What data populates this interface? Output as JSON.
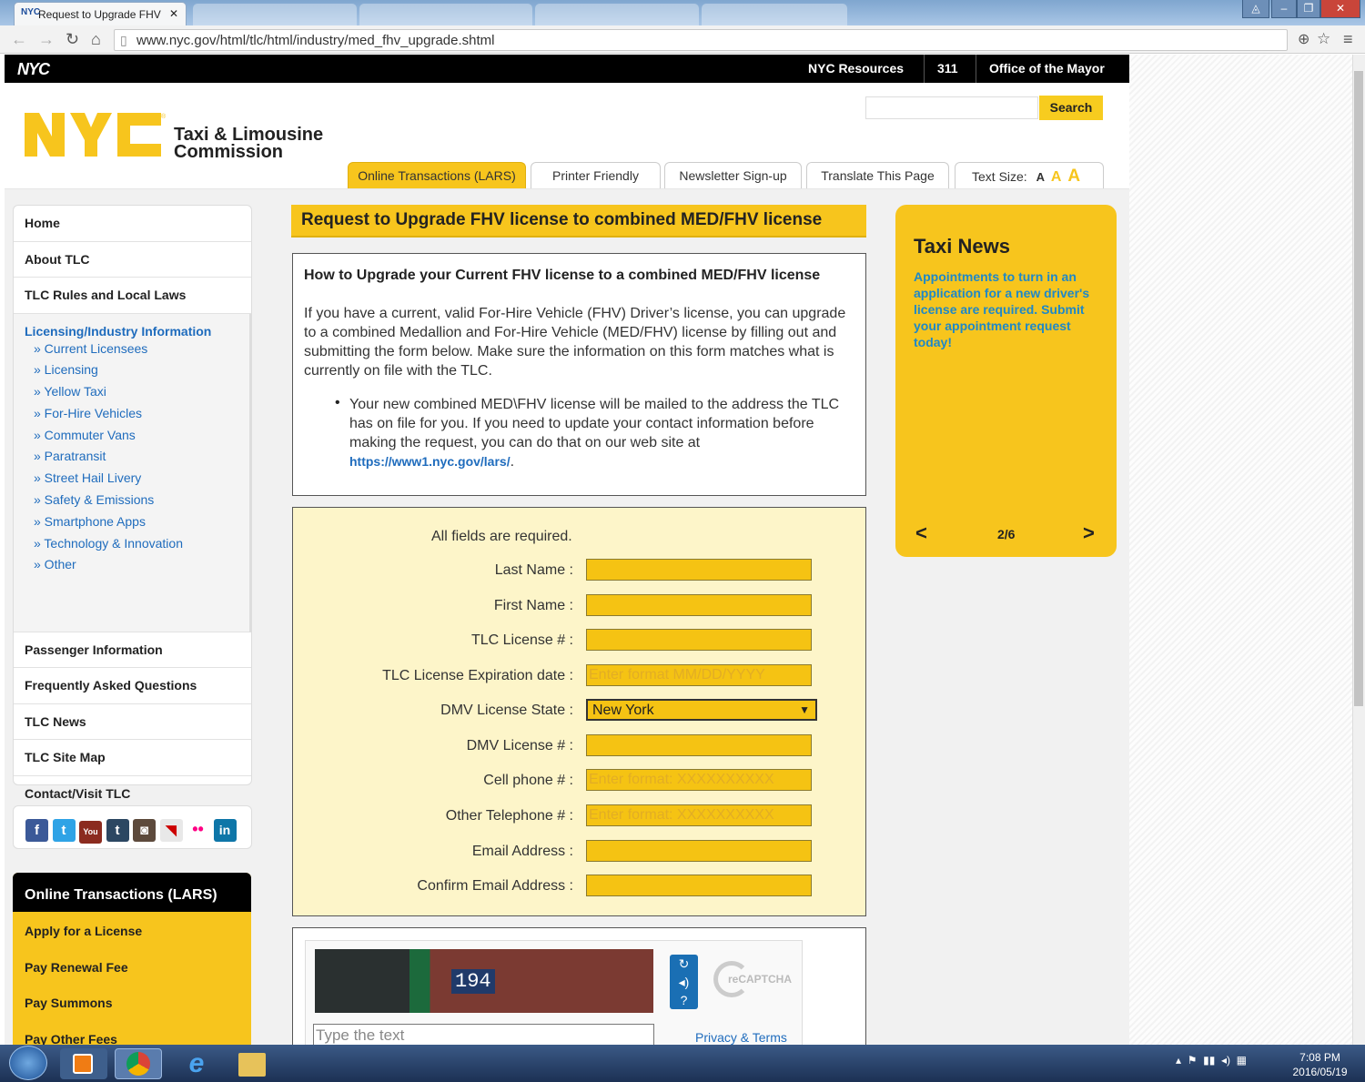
{
  "browser": {
    "tab_title": "Request to Upgrade FHV",
    "url": "www.nyc.gov/html/tlc/html/industry/med_fhv_upgrade.shtml"
  },
  "topbar": {
    "brand": "NYC",
    "links": [
      "NYC Resources",
      "311",
      "Office of the Mayor"
    ]
  },
  "header": {
    "logo_text": "NYC",
    "agency_line1": "Taxi & Limousine",
    "agency_line2": "Commission",
    "search_label": "Search",
    "tabs": [
      "Online Transactions (LARS)",
      "Printer Friendly",
      "Newsletter Sign-up",
      "Translate This Page"
    ],
    "text_size_label": "Text Size:",
    "text_size_glyph": "A"
  },
  "sidebar": {
    "top_items": [
      "Home",
      "About TLC",
      "TLC Rules and Local Laws"
    ],
    "active_item": "Licensing/Industry Information",
    "sub_items": [
      "» Current Licensees",
      "» Licensing",
      "» Yellow Taxi",
      "» For-Hire Vehicles",
      "» Commuter Vans",
      "» Paratransit",
      "» Street Hail Livery",
      "» Safety & Emissions",
      "» Smartphone Apps",
      "» Technology & Innovation",
      "» Other"
    ],
    "bottom_items": [
      "Passenger Information",
      "Frequently Asked Questions",
      "TLC News",
      "TLC Site Map",
      "Contact/Visit TLC"
    ],
    "social_icons": [
      "facebook-icon",
      "twitter-icon",
      "youtube-icon",
      "tumblr-icon",
      "instagram-icon",
      "ndf-icon",
      "flickr-icon",
      "linkedin-icon"
    ],
    "lars": {
      "title": "Online Transactions (LARS)",
      "items": [
        "Apply for a License",
        "Pay Renewal Fee",
        "Pay Summons",
        "Pay Other Fees"
      ]
    }
  },
  "main": {
    "title": "Request to Upgrade FHV license to combined MED/FHV license",
    "info_heading": "How to Upgrade your Current FHV license to a combined MED/FHV license",
    "info_paragraph": "If you have a current, valid For-Hire Vehicle (FHV) Driver’s license, you can upgrade to a combined Medallion and For-Hire Vehicle (MED/FHV) license by filling out and submitting the form below. Make sure the information on this form matches what is currently on file with the TLC.",
    "bullet_text": "Your new combined MED\\FHV license will be mailed to the address the TLC has on file for you. If you need to update your contact information before making the request, you can do that on our web site at",
    "bullet_link": "https://www1.nyc.gov/lars/",
    "form": {
      "required_note": "All fields are required.",
      "fields": [
        {
          "label": "Last Name :",
          "value": "",
          "placeholder": ""
        },
        {
          "label": "First Name :",
          "value": "",
          "placeholder": ""
        },
        {
          "label": "TLC License # :",
          "value": "",
          "placeholder": ""
        },
        {
          "label": "TLC License Expiration date :",
          "value": "",
          "placeholder": "Enter format MM/DD/YYYY"
        },
        {
          "label": "DMV License State :",
          "value": "New York",
          "placeholder": ""
        },
        {
          "label": "DMV License # :",
          "value": "",
          "placeholder": ""
        },
        {
          "label": "Cell phone # :",
          "value": "",
          "placeholder": "Enter format: XXXXXXXXXX"
        },
        {
          "label": "Other Telephone # :",
          "value": "",
          "placeholder": "Enter format: XXXXXXXXXX"
        },
        {
          "label": "Email Address :",
          "value": "",
          "placeholder": ""
        },
        {
          "label": "Confirm Email Address :",
          "value": "",
          "placeholder": ""
        }
      ]
    },
    "captcha": {
      "image_text": "194",
      "input_placeholder": "Type the text",
      "privacy_link": "Privacy & Terms",
      "logo_text": "reCAPTCHA"
    }
  },
  "news": {
    "title": "Taxi News",
    "body": "Appointments to turn in an application for a new driver's license are required. Submit your appointment request today!",
    "prev": "<",
    "next": ">",
    "pager": "2/6"
  },
  "taskbar": {
    "time": "7:08 PM",
    "date": "2016/05/19"
  },
  "colors": {
    "nyc_yellow": "#f7c51d",
    "link_blue": "#1f6cbd",
    "news_blue": "#1e88c8",
    "input_yellow": "#f5c313"
  }
}
